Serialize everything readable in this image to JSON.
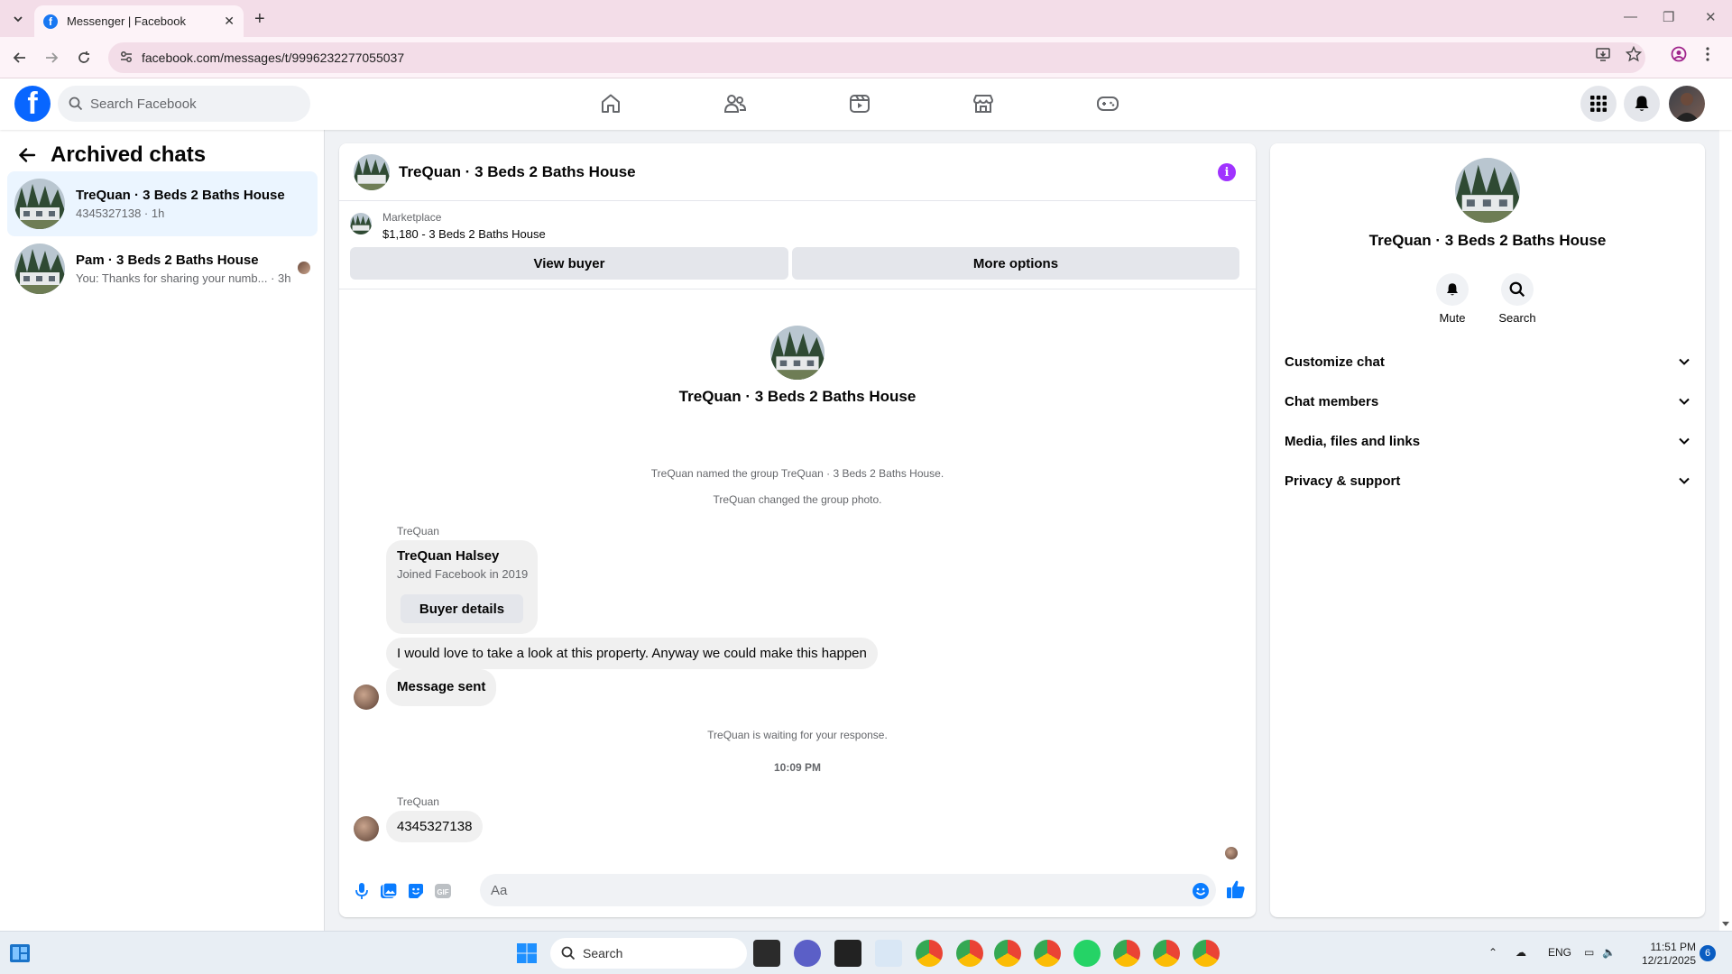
{
  "browser": {
    "tab_title": "Messenger | Facebook",
    "url": "facebook.com/messages/t/9996232277055037"
  },
  "fb": {
    "search_placeholder": "Search Facebook"
  },
  "sidebar": {
    "title": "Archived chats",
    "chats": [
      {
        "name": "TreQuan · 3 Beds 2 Baths House",
        "preview": "4345327138 · 1h"
      },
      {
        "name": "Pam · 3 Beds 2 Baths House",
        "preview": "You: Thanks for sharing your numb... · 3h"
      }
    ]
  },
  "conversation": {
    "title": "TreQuan · 3 Beds 2 Baths House",
    "marketplace_label": "Marketplace",
    "listing": "$1,180 - 3 Beds 2 Baths House",
    "view_buyer": "View buyer",
    "more_options": "More options",
    "intro_title": "TreQuan · 3 Beds 2 Baths House",
    "system_1": "TreQuan named the group TreQuan · 3 Beds 2 Baths House.",
    "system_2": "TreQuan changed the group photo.",
    "sender_1": "TreQuan",
    "card_name": "TreQuan Halsey",
    "card_sub": "Joined Facebook in 2019",
    "card_button": "Buyer details",
    "message_1": "I would love to take a look at this property. Anyway we could make this happen",
    "message_2": "Message sent",
    "system_3": "TreQuan is waiting for your response.",
    "timestamp": "10:09 PM",
    "sender_2": "TreQuan",
    "message_3": "4345327138",
    "composer_placeholder": "Aa"
  },
  "right_panel": {
    "title": "TreQuan · 3 Beds 2 Baths House",
    "mute": "Mute",
    "search": "Search",
    "sections": [
      "Customize chat",
      "Chat members",
      "Media, files and links",
      "Privacy & support"
    ]
  },
  "taskbar": {
    "search": "Search",
    "lang": "ENG",
    "time": "11:51 PM",
    "date": "12/21/2025",
    "notif_count": "6"
  },
  "colors": {
    "accent": "#0866ff",
    "info": "#a033ff",
    "like": "#0a7cff"
  }
}
